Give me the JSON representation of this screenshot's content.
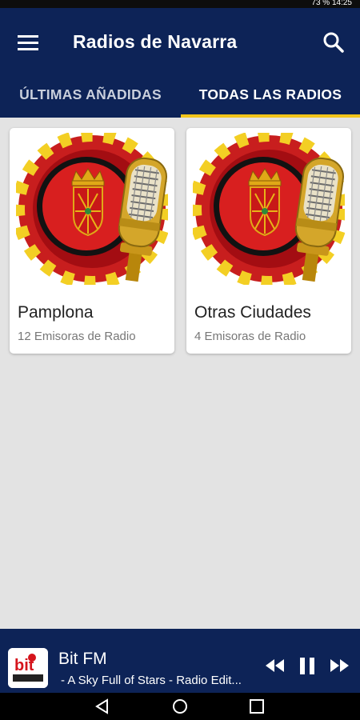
{
  "status_bar": {
    "text": "73 %  14:25"
  },
  "app_bar": {
    "title": "Radios de Navarra"
  },
  "tabs": [
    {
      "label": "ÚLTIMAS AÑADIDAS"
    },
    {
      "label": "TODAS LAS RADIOS"
    }
  ],
  "cards": [
    {
      "title": "Pamplona",
      "subtitle": "12 Emisoras de Radio"
    },
    {
      "title": "Otras Ciudades",
      "subtitle": "4 Emisoras de Radio"
    }
  ],
  "player": {
    "station": "Bit FM",
    "track": " - A Sky Full of Stars - Radio Edit..."
  },
  "icons": {
    "menu": "menu-icon",
    "search": "search-icon",
    "rewind": "rewind-icon",
    "pause": "pause-icon",
    "fast_forward": "fast-forward-icon",
    "nav_back": "back-icon",
    "nav_home": "home-icon",
    "nav_recents": "recents-icon"
  },
  "colors": {
    "primary": "#0d2357",
    "accent": "#f2c51b",
    "background": "#e3e3e3"
  }
}
